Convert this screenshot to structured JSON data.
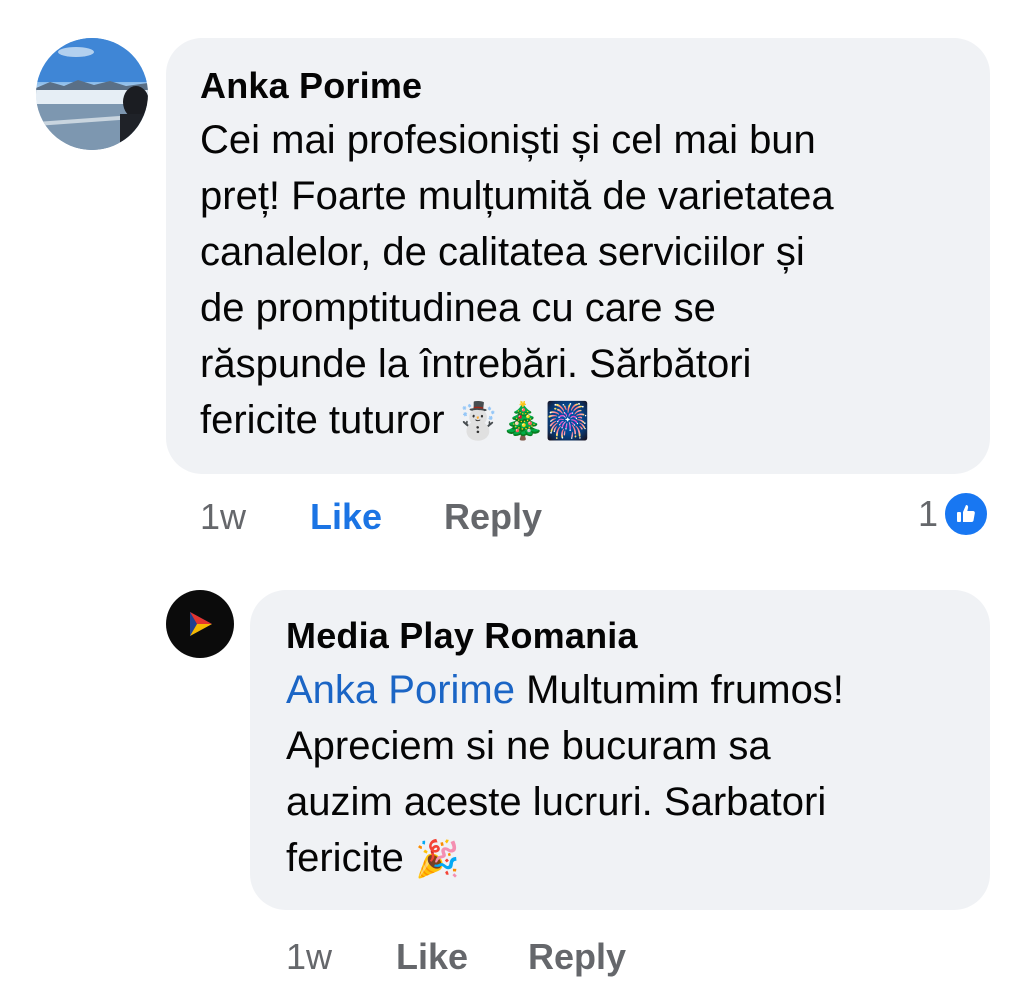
{
  "comment": {
    "author": "Anka Porime",
    "text_lines": [
      "Cei mai profesioniști și cel mai bun",
      "preț! Foarte mulțumită de varietatea",
      "canalelor, de calitatea serviciilor și",
      "de promptitudinea cu care se",
      "răspunde la întrebări. Sărbători",
      "fericite tuturor"
    ],
    "emojis": [
      "☃️",
      "🎄",
      "🎆"
    ],
    "time": "1w",
    "like_label": "Like",
    "reply_label": "Reply",
    "reaction_count": "1",
    "reaction_icon": "like-thumb-icon",
    "avatar_icon": "mountain-landscape-photo"
  },
  "reply": {
    "author": "Media Play Romania",
    "mention": "Anka Porime",
    "text_lines": [
      "Multumim frumos!",
      "Apreciem si ne bucuram sa",
      "auzim aceste lucruri. Sarbatori",
      "fericite"
    ],
    "emoji": "🎉",
    "time": "1w",
    "like_label": "Like",
    "reply_label": "Reply",
    "avatar_icon": "play-triangle-logo"
  },
  "colors": {
    "bubble": "#f0f2f5",
    "link_blue": "#1b74e4",
    "meta_gray": "#65676b",
    "like_badge": "#1877f2"
  }
}
